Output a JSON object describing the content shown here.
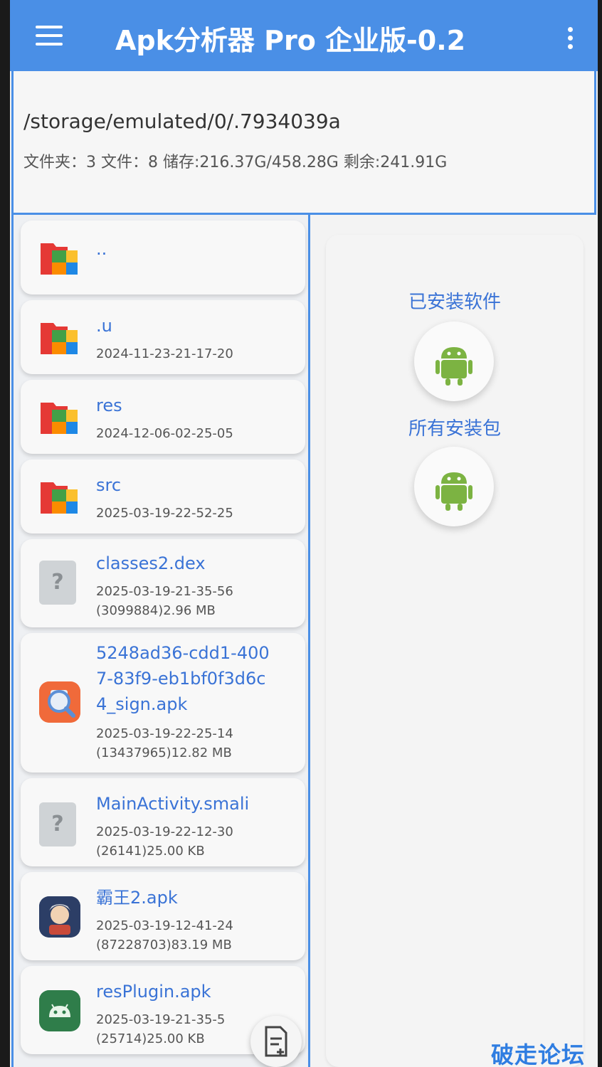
{
  "appbar": {
    "title": "Apk分析器 Pro 企业版-0.2",
    "menu_icon": "hamburger-menu-icon",
    "more_icon": "more-vertical-icon"
  },
  "pathbar": {
    "path": "/storage/emulated/0/.7934039a",
    "stats": "文件夹：3  文件：8   储存:216.37G/458.28G  剩余:241.91G"
  },
  "files": [
    {
      "name": "..",
      "meta1": "",
      "meta2": "",
      "icon": "folder-icon"
    },
    {
      "name": ".u",
      "meta1": "2024-11-23-21-17-20",
      "meta2": "",
      "icon": "folder-icon"
    },
    {
      "name": "res",
      "meta1": "2024-12-06-02-25-05",
      "meta2": "",
      "icon": "folder-icon"
    },
    {
      "name": "src",
      "meta1": "2025-03-19-22-52-25",
      "meta2": "",
      "icon": "folder-icon"
    },
    {
      "name": "classes2.dex",
      "meta1": "2025-03-19-21-35-56",
      "meta2": "(3099884)2.96 MB",
      "icon": "unknown-file-icon",
      "glyph": "?"
    },
    {
      "name_lines": [
        "5248ad36-cdd1-400",
        "7-83f9-eb1bf0f3d6c",
        "4_sign.apk"
      ],
      "meta1": "2025-03-19-22-25-14",
      "meta2": "(13437965)12.82 MB",
      "icon": "apk-analyzer-icon"
    },
    {
      "name": "MainActivity.smali",
      "meta1": "2025-03-19-22-12-30",
      "meta2": "(26141)25.00 KB",
      "icon": "unknown-file-icon",
      "glyph": "?"
    },
    {
      "name": "霸王2.apk",
      "meta1": "2025-03-19-12-41-24",
      "meta2": "(87228703)83.19 MB",
      "icon": "game-app-icon"
    },
    {
      "name": "resPlugin.apk",
      "meta1": "2025-03-19-21-35-5",
      "meta2": "(25714)25.00 KB",
      "icon": "android-app-icon"
    }
  ],
  "right_panel": {
    "installed_label": "已安装软件",
    "packages_label": "所有安装包",
    "button_icon": "android-robot-icon"
  },
  "fab": {
    "icon": "add-file-icon"
  },
  "watermark": "破走论坛",
  "colors": {
    "accent": "#4a8fe6",
    "link": "#3a73d6"
  }
}
